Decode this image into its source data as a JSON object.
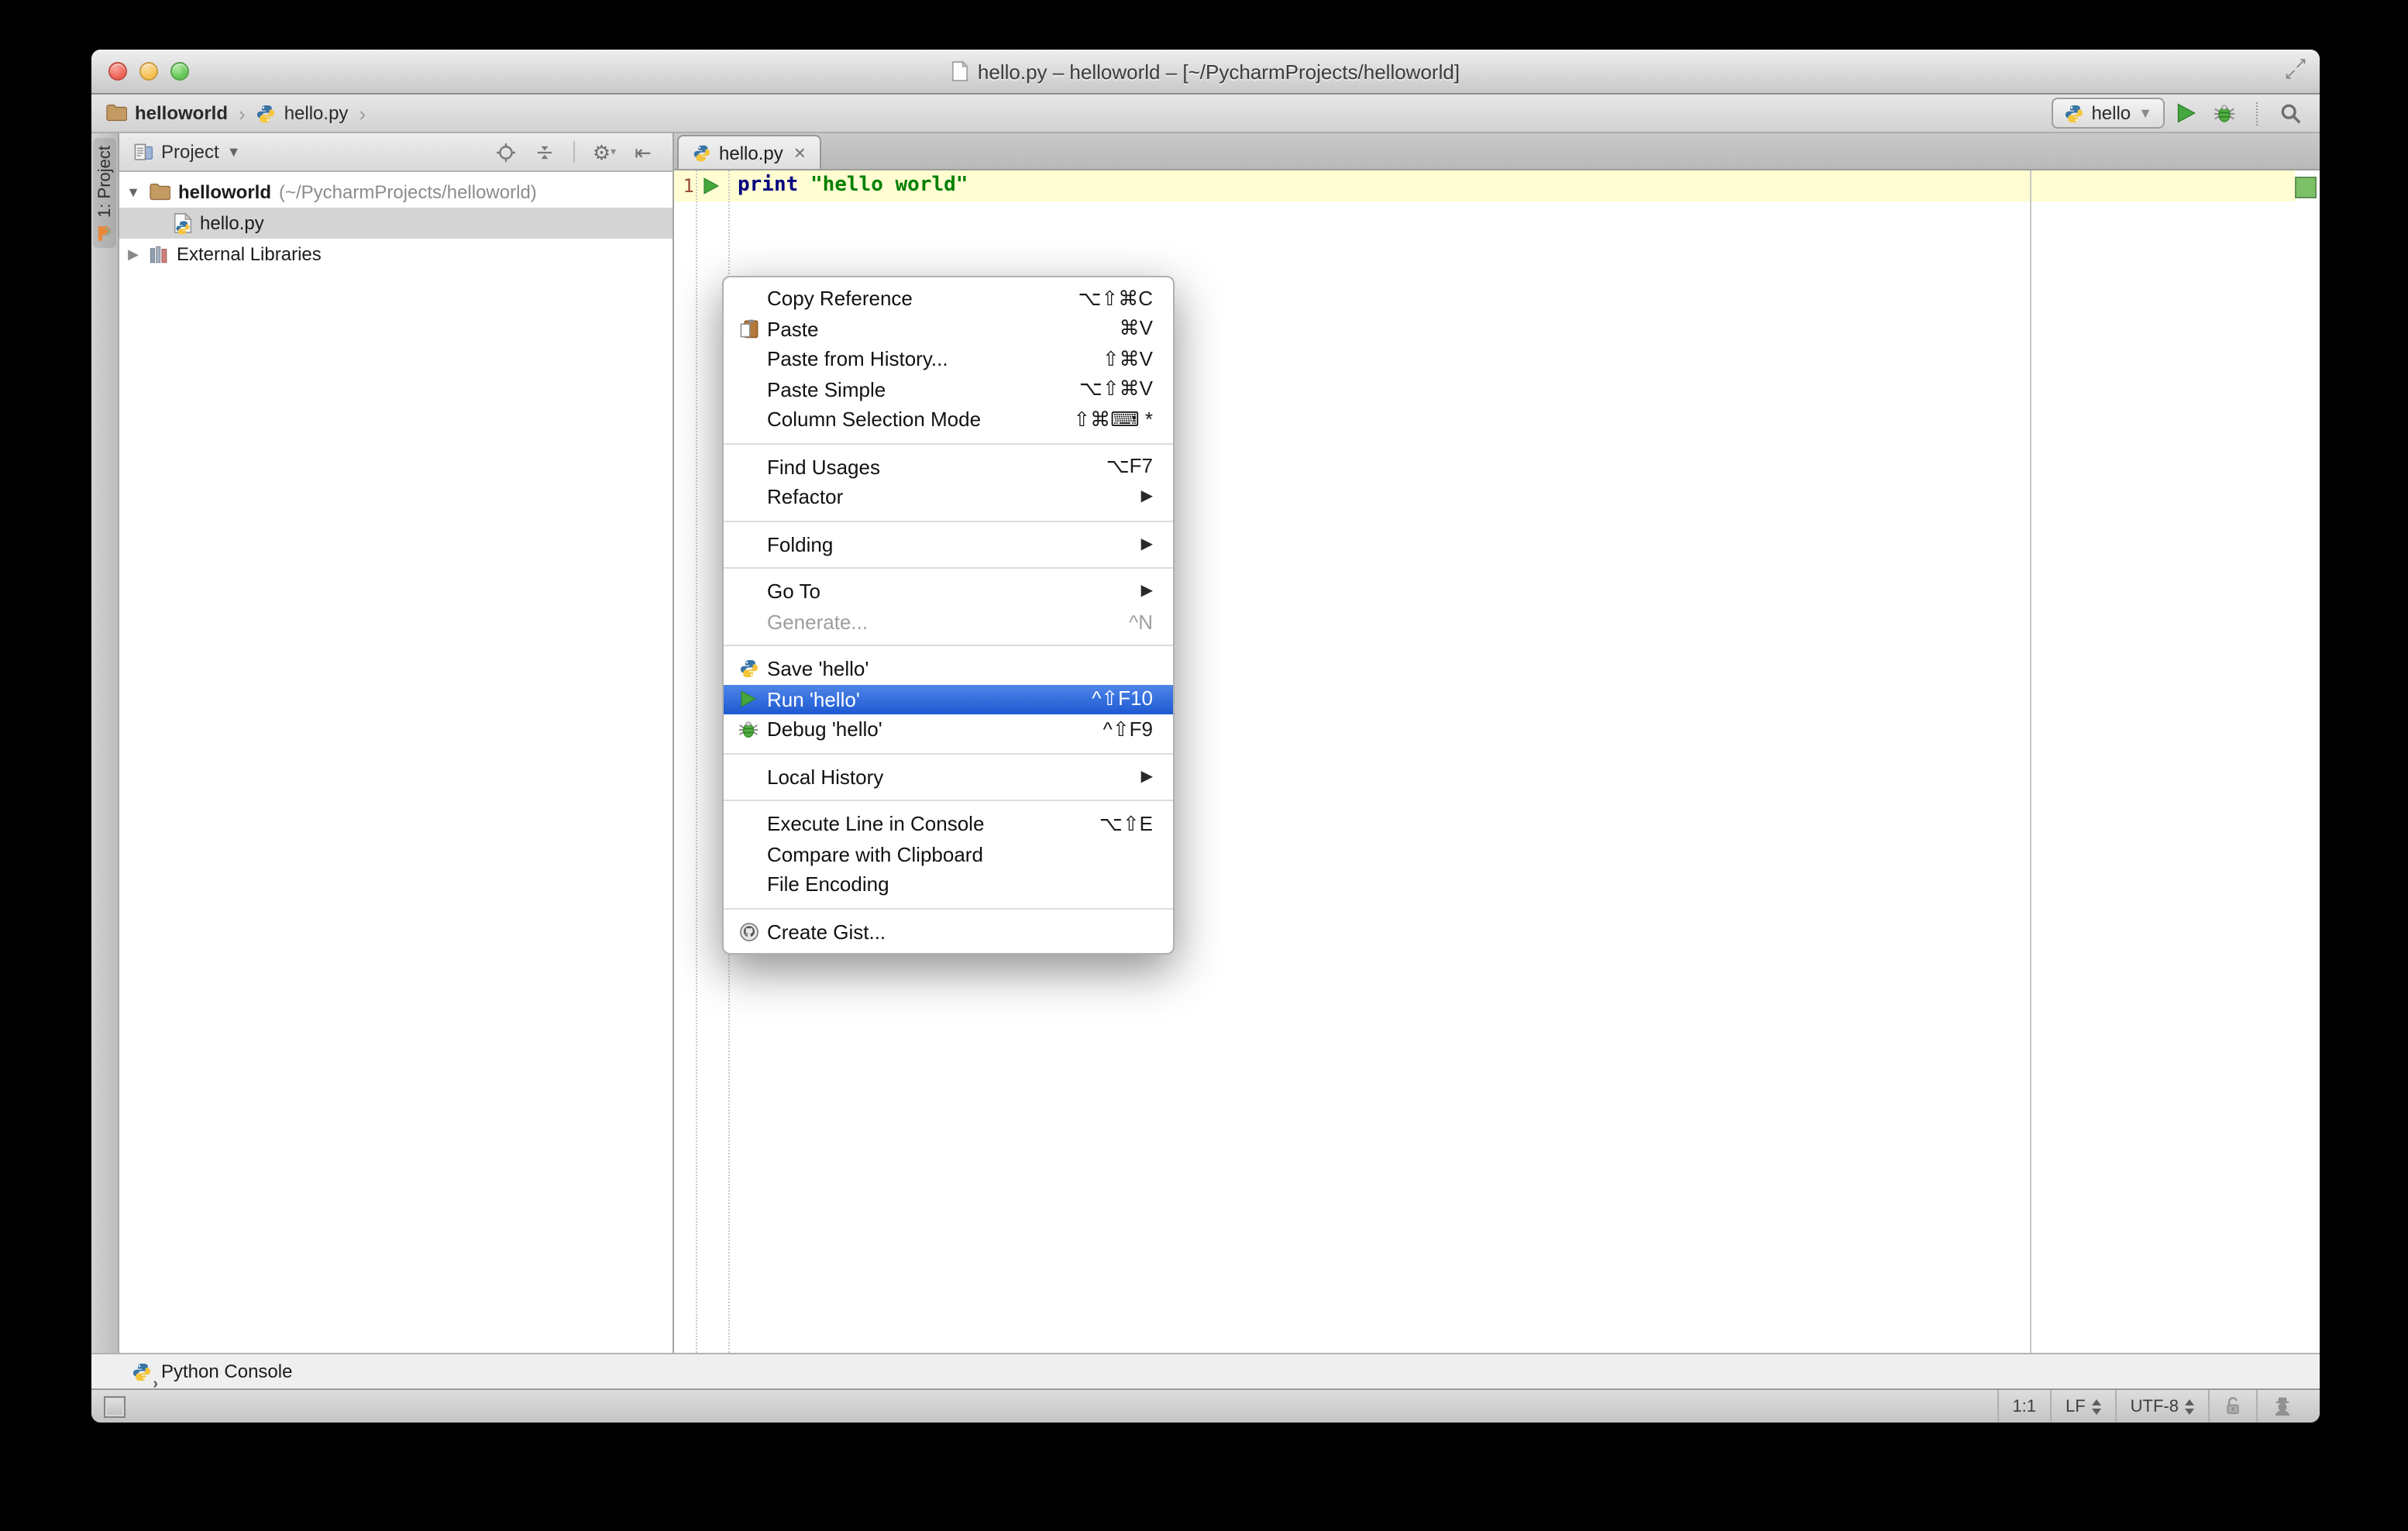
{
  "icons": {
    "chevron": "›",
    "dropdown_small": "▾",
    "dropdown": "▼",
    "submenu_arrow": "▶",
    "tree_expanded": "▼",
    "tree_collapsed": "▶",
    "tab_close": "×",
    "gear": "⚙",
    "hide_panel": "⇤",
    "fullscreen_ne": "↗",
    "fullscreen_sw": "↙"
  },
  "window": {
    "title": "hello.py – helloworld – [~/PycharmProjects/helloworld]"
  },
  "breadcrumbs": {
    "project": "helloworld",
    "file": "hello.py"
  },
  "toolbar": {
    "run_config": "hello"
  },
  "stripe": {
    "project_button": "1: Project"
  },
  "project_panel": {
    "title": "Project",
    "tree": [
      {
        "label": "helloworld",
        "path": "(~/PycharmProjects/helloworld)"
      },
      {
        "label": "hello.py"
      },
      {
        "label": "External Libraries"
      }
    ]
  },
  "editor": {
    "tab": "hello.py",
    "line_number": "1",
    "code_keyword": "print",
    "code_string": "\"hello world\""
  },
  "context_menu": {
    "sections": [
      {
        "items": [
          {
            "label": "Copy Reference",
            "shortcut": "⌥⇧⌘C"
          },
          {
            "label": "Paste",
            "shortcut": "⌘V"
          },
          {
            "label": "Paste from History...",
            "shortcut": "⇧⌘V"
          },
          {
            "label": "Paste Simple",
            "shortcut": "⌥⇧⌘V"
          },
          {
            "label": "Column Selection Mode",
            "shortcut": "⇧⌘⌨ *"
          }
        ]
      },
      {
        "items": [
          {
            "label": "Find Usages",
            "shortcut": "⌥F7"
          },
          {
            "label": "Refactor"
          }
        ]
      },
      {
        "items": [
          {
            "label": "Folding"
          }
        ]
      },
      {
        "items": [
          {
            "label": "Go To"
          },
          {
            "label": "Generate...",
            "shortcut": "^N"
          }
        ]
      },
      {
        "items": [
          {
            "label": "Save 'hello'"
          },
          {
            "label": "Run 'hello'",
            "shortcut": "^⇧F10"
          },
          {
            "label": "Debug 'hello'",
            "shortcut": "^⇧F9"
          }
        ]
      },
      {
        "items": [
          {
            "label": "Local History"
          }
        ]
      },
      {
        "items": [
          {
            "label": "Execute Line in Console",
            "shortcut": "⌥⇧E"
          },
          {
            "label": "Compare with Clipboard"
          },
          {
            "label": "File Encoding"
          }
        ]
      },
      {
        "items": [
          {
            "label": "Create Gist..."
          }
        ]
      }
    ]
  },
  "console_bar": {
    "label": "Python Console"
  },
  "status_bar": {
    "caret_position": "1:1",
    "line_separator": "LF",
    "encoding": "UTF-8"
  },
  "colors": {
    "selection_blue": "#2E62D9",
    "run_green": "#3EA33E",
    "current_line": "#FFFDD1",
    "keyword": "#000080",
    "string": "#008000"
  }
}
